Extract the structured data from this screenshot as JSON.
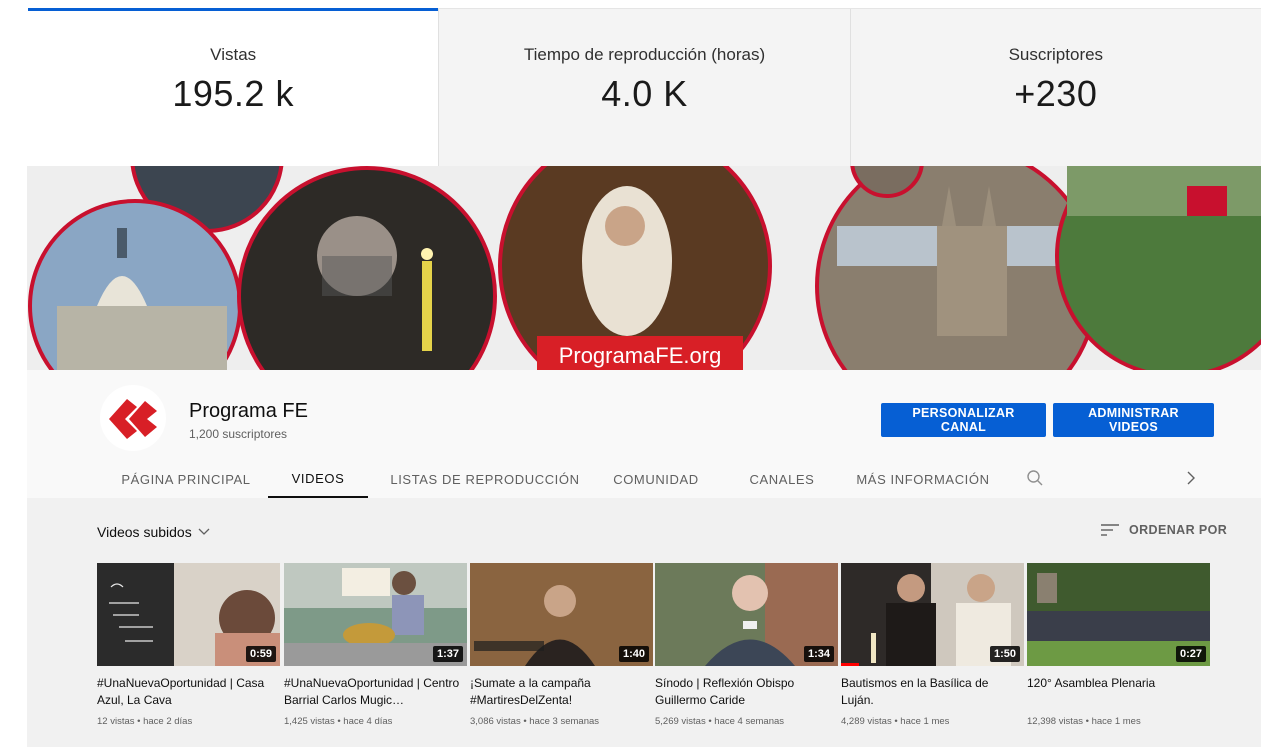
{
  "stats": [
    {
      "label": "Vistas",
      "value": "195.2 k"
    },
    {
      "label": "Tiempo de reproducción (horas)",
      "value": "4.0 K"
    },
    {
      "label": "Suscriptores",
      "value": "+230"
    }
  ],
  "banner": {
    "url_text": "ProgramaFE.org"
  },
  "channel": {
    "name": "Programa FE",
    "subscribers": "1,200 suscriptores",
    "customize_label": "PERSONALIZAR CANAL",
    "manage_label": "ADMINISTRAR VIDEOS"
  },
  "tabs": [
    {
      "label": "PÁGINA PRINCIPAL"
    },
    {
      "label": "VIDEOS"
    },
    {
      "label": "LISTAS DE REPRODUCCIÓN"
    },
    {
      "label": "COMUNIDAD"
    },
    {
      "label": "CANALES"
    },
    {
      "label": "MÁS INFORMACIÓN"
    }
  ],
  "section": {
    "title": "Videos subidos",
    "sort_label": "ORDENAR POR"
  },
  "videos": [
    {
      "title": "#UnaNuevaOportunidad | Casa Azul, La Cava",
      "meta": "12 vistas • hace 2 días",
      "duration": "0:59"
    },
    {
      "title": "#UnaNuevaOportunidad | Centro Barrial Carlos Mugic…",
      "meta": "1,425 vistas • hace 4 días",
      "duration": "1:37"
    },
    {
      "title": "¡Sumate a la campaña #MartiresDelZenta!",
      "meta": "3,086 vistas • hace 3 semanas",
      "duration": "1:40"
    },
    {
      "title": "Sínodo | Reflexión Obispo Guillermo Caride",
      "meta": "5,269 vistas • hace 4 semanas",
      "duration": "1:34"
    },
    {
      "title": "Bautismos en la Basílica de Luján.",
      "meta": "4,289 vistas • hace 1 mes",
      "duration": "1:50"
    },
    {
      "title": "120° Asamblea Plenaria",
      "meta": "12,398 vistas • hace 1 mes",
      "duration": "0:27"
    }
  ],
  "colors": {
    "accent": "#065fd4",
    "brand_red": "#d81f26"
  }
}
